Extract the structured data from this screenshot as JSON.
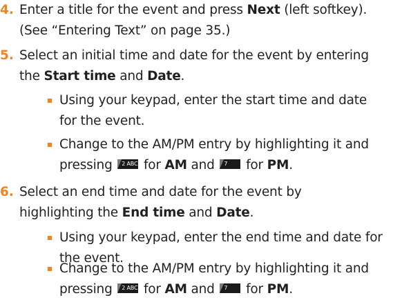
{
  "steps": [
    {
      "number": "4.",
      "line1_pre": "Enter a title for the event and press ",
      "line1_bold": "Next",
      "line1_post": " (left softkey).",
      "line2": "(See “Entering Text” on page 35.)"
    },
    {
      "number": "5.",
      "line1": "Select an initial time and date for the event by entering",
      "line2_pre": "the ",
      "line2_bold1": "Start time",
      "line2_mid": " and ",
      "line2_bold2": "Date",
      "line2_post": "."
    },
    {
      "number": "6.",
      "line1": "Select an end time and date for the event by",
      "line2_pre": "highlighting the ",
      "line2_bold1": "End time",
      "line2_mid": " and ",
      "line2_bold2": "Date",
      "line2_post": "."
    }
  ],
  "bullets": {
    "b1": {
      "line1": "Using your keypad, enter the start time and date",
      "line2": "for the event."
    },
    "b2": {
      "line1": "Change to the AM/PM entry by highlighting it and",
      "line2_pre": "pressing ",
      "key1": "2 ABC",
      "mid": " for ",
      "bold1": "AM",
      "and": " and ",
      "key2": "7 PQRS",
      "for2": " for ",
      "bold2": "PM",
      "post": "."
    },
    "b3": {
      "line1": "Using your keypad, enter the end time and date for",
      "line2": "the event."
    },
    "b4": {
      "line1": "Change to the AM/PM entry by highlighting it and",
      "line2_pre": "pressing ",
      "key1": "2 ABC",
      "mid": " for ",
      "bold1": "AM",
      "and": " and ",
      "key2": "7 PQRS",
      "for2": " for ",
      "bold2": "PM",
      "post": "."
    }
  },
  "colors": {
    "accent": "#f58220",
    "text": "#231f20",
    "key": "#1a1a1a"
  }
}
